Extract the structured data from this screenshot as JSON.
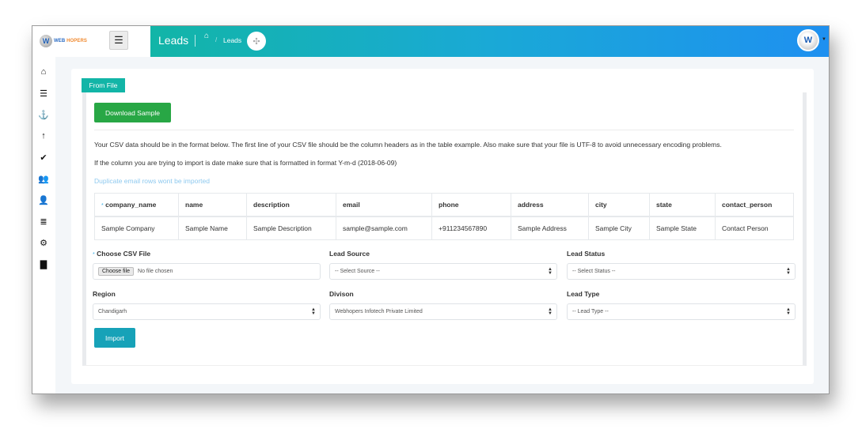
{
  "brand": {
    "logo_mark": "W",
    "name_part1": "WEB",
    "name_part2": " HOPERS"
  },
  "header": {
    "menu_icon": "☰",
    "title": "Leads",
    "breadcrumb": {
      "home_icon": "⌂",
      "separator": "/",
      "current": "Leads"
    },
    "action_icon": "✣",
    "avatar_initial": "W",
    "avatar_caret": "▼"
  },
  "sidebar": {
    "items": [
      {
        "name": "home",
        "icon": "⌂"
      },
      {
        "name": "list",
        "icon": "☰"
      },
      {
        "name": "anchor",
        "icon": "⚓"
      },
      {
        "name": "upload",
        "icon": "↑"
      },
      {
        "name": "user-check",
        "icon": "✔"
      },
      {
        "name": "users",
        "icon": "👥"
      },
      {
        "name": "user",
        "icon": "👤"
      },
      {
        "name": "database",
        "icon": "≣"
      },
      {
        "name": "settings",
        "icon": "⚙"
      },
      {
        "name": "folder",
        "icon": "▇"
      }
    ]
  },
  "tab": {
    "label": "From File"
  },
  "panel": {
    "download_label": "Download Sample",
    "info_lines": [
      "Your CSV data should be in the format below. The first line of your CSV file should be the column headers as in the table example. Also make sure that your file is UTF-8 to avoid unnecessary encoding problems.",
      "If the column you are trying to import is date make sure that is formatted in format Y-m-d (2018-06-09)",
      "Duplicate email rows wont be imported"
    ],
    "required_mark": "*",
    "table": {
      "headers": [
        "company_name",
        "name",
        "description",
        "email",
        "phone",
        "address",
        "city",
        "state",
        "contact_person"
      ],
      "rows": [
        [
          "Sample Company",
          "Sample Name",
          "Sample Description",
          "sample@sample.com",
          "+911234567890",
          "Sample Address",
          "Sample City",
          "Sample State",
          "Contact Person"
        ]
      ]
    },
    "form": {
      "csv_label": "Choose CSV File",
      "file_button": "Choose file",
      "file_status": "No file chosen",
      "lead_source_label": "Lead Source",
      "lead_source_value": "-- Select Source --",
      "lead_status_label": "Lead Status",
      "lead_status_value": "-- Select Status --",
      "region_label": "Region",
      "region_value": "Chandigarh",
      "division_label": "Divison",
      "division_value": "Webhopers Infotech Private Limited",
      "lead_type_label": "Lead Type",
      "lead_type_value": "-- Lead Type --"
    },
    "import_label": "Import"
  },
  "colors": {
    "header_gradient_start": "#12b5a7",
    "header_gradient_end": "#1e90f0",
    "download_button": "#28a745",
    "import_button": "#17a2b8",
    "notice_text": "#8ec9ef"
  }
}
